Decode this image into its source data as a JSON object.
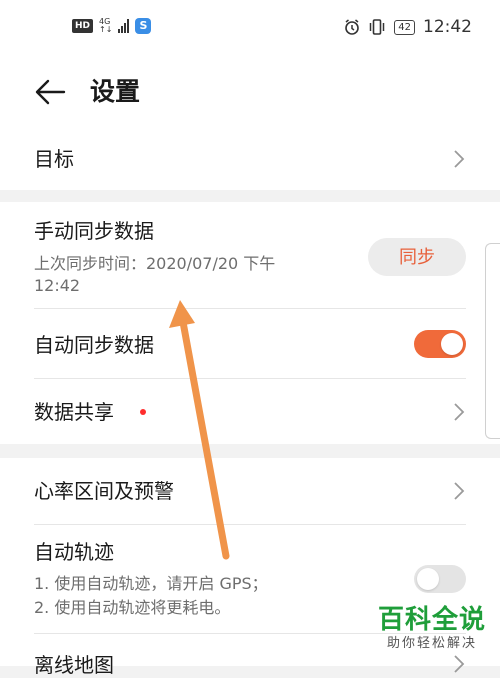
{
  "status_bar": {
    "hd": "HD",
    "network": "4G",
    "network_sub": "↑↓",
    "app_icon_letter": "S",
    "battery": "42",
    "time": "12:42"
  },
  "header": {
    "title": "设置"
  },
  "items": {
    "goal": {
      "label": "目标"
    },
    "manual_sync": {
      "label": "手动同步数据",
      "sub_line1": "上次同步时间：2020/07/20 下午",
      "sub_line2": "12:42",
      "button": "同步"
    },
    "auto_sync": {
      "label": "自动同步数据",
      "toggle": "on"
    },
    "data_share": {
      "label": "数据共享",
      "has_badge": true
    },
    "heart_rate": {
      "label": "心率区间及预警"
    },
    "auto_track": {
      "label": "自动轨迹",
      "sub_line1": "1. 使用自动轨迹，请开启 GPS；",
      "sub_line2": "2. 使用自动轨迹将更耗电。",
      "toggle": "off"
    },
    "offline_map": {
      "label": "离线地图"
    }
  },
  "watermark": {
    "main": "百科全说",
    "sub": "助你轻松解决"
  },
  "colors": {
    "accent": "#f06a3a",
    "annotation_arrow": "#f0944a",
    "watermark_green": "#1f9e3a"
  },
  "icons": {
    "back": "back-arrow-icon",
    "chevron": "chevron-right-icon",
    "alarm": "alarm-icon",
    "vibrate": "vibrate-icon"
  }
}
